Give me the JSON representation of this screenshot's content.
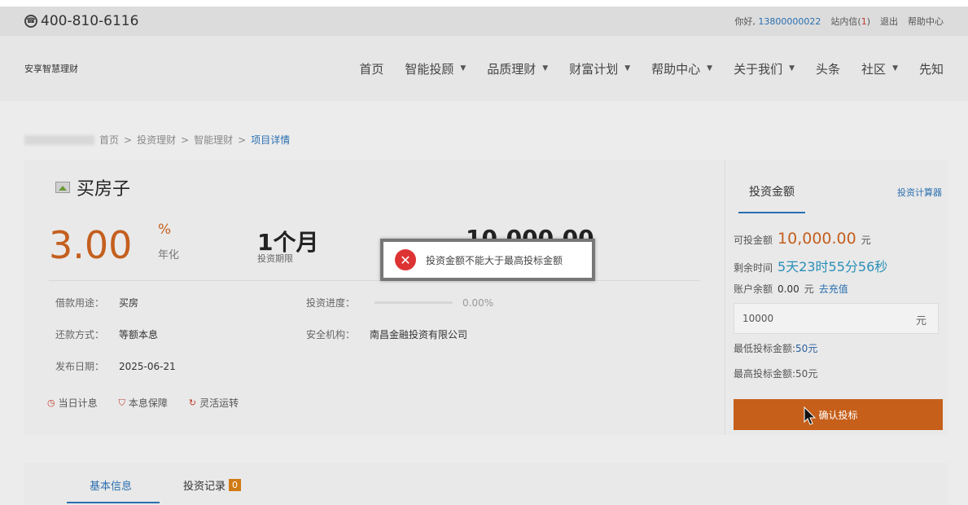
{
  "topbar": {
    "phone": "400-810-6116",
    "greeting": "你好,",
    "user": "13800000022",
    "messages_label": "站内信(",
    "messages_count": "1",
    "messages_close": ")",
    "logout": "退出",
    "help": "帮助中心"
  },
  "brand": "安享智慧理财",
  "nav": {
    "items": [
      {
        "label": "首页",
        "dropdown": false
      },
      {
        "label": "智能投顾",
        "dropdown": true
      },
      {
        "label": "品质理财",
        "dropdown": true
      },
      {
        "label": "财富计划",
        "dropdown": true
      },
      {
        "label": "帮助中心",
        "dropdown": true
      },
      {
        "label": "关于我们",
        "dropdown": true
      },
      {
        "label": "头条",
        "dropdown": false
      },
      {
        "label": "社区",
        "dropdown": true
      },
      {
        "label": "先知",
        "dropdown": false
      }
    ]
  },
  "breadcrumb": {
    "items": [
      "首页",
      "投资理财",
      "智能理财"
    ],
    "current": "项目详情",
    "sep": ">"
  },
  "project": {
    "title": "买房子",
    "rate": "3.00",
    "rate_unit": "%",
    "rate_label": "年化",
    "term": "1个月",
    "term_label": "投资期限",
    "amount": "10,000.00",
    "purpose_label": "借款用途：",
    "purpose": "买房",
    "repay_label": "还款方式：",
    "repay": "等额本息",
    "date_label": "发布日期：",
    "date": "2025-06-21",
    "progress_label": "投资进度：",
    "progress_text": "0.00%",
    "progress_value": 0,
    "agency_label": "安全机构：",
    "agency": "南昌金融投资有限公司",
    "tags": [
      "当日计息",
      "本息保障",
      "灵活运转"
    ]
  },
  "side": {
    "tab": "投资金额",
    "calculator": "投资计算器",
    "investable_label": "可投金额",
    "investable": "10,000.00",
    "yuan": "元",
    "remaining_label": "剩余时间",
    "remaining": "5天23时55分56秒",
    "balance_label": "账户余额",
    "balance": "0.00",
    "recharge": "去充值",
    "input_value": "10000",
    "min_label": "最低投标金额:",
    "min_value": "50元",
    "max_label": "最高投标金额:",
    "max_value": "50元",
    "confirm": "确认投标"
  },
  "tabs": {
    "basic": "基本信息",
    "records": "投资记录",
    "records_count": "0"
  },
  "dialog": {
    "message": "投资金额不能大于最高投标金额"
  },
  "colors": {
    "accent_orange": "#c65f1a",
    "link_blue": "#2a6fb0",
    "error_red": "#d33333"
  }
}
